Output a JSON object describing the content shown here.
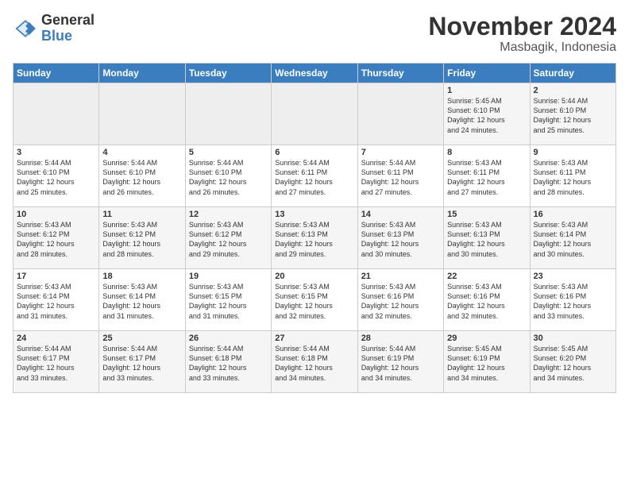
{
  "logo": {
    "general": "General",
    "blue": "Blue"
  },
  "title": "November 2024",
  "location": "Masbagik, Indonesia",
  "days_of_week": [
    "Sunday",
    "Monday",
    "Tuesday",
    "Wednesday",
    "Thursday",
    "Friday",
    "Saturday"
  ],
  "weeks": [
    [
      {
        "day": "",
        "info": ""
      },
      {
        "day": "",
        "info": ""
      },
      {
        "day": "",
        "info": ""
      },
      {
        "day": "",
        "info": ""
      },
      {
        "day": "",
        "info": ""
      },
      {
        "day": "1",
        "info": "Sunrise: 5:45 AM\nSunset: 6:10 PM\nDaylight: 12 hours\nand 24 minutes."
      },
      {
        "day": "2",
        "info": "Sunrise: 5:44 AM\nSunset: 6:10 PM\nDaylight: 12 hours\nand 25 minutes."
      }
    ],
    [
      {
        "day": "3",
        "info": "Sunrise: 5:44 AM\nSunset: 6:10 PM\nDaylight: 12 hours\nand 25 minutes."
      },
      {
        "day": "4",
        "info": "Sunrise: 5:44 AM\nSunset: 6:10 PM\nDaylight: 12 hours\nand 26 minutes."
      },
      {
        "day": "5",
        "info": "Sunrise: 5:44 AM\nSunset: 6:10 PM\nDaylight: 12 hours\nand 26 minutes."
      },
      {
        "day": "6",
        "info": "Sunrise: 5:44 AM\nSunset: 6:11 PM\nDaylight: 12 hours\nand 27 minutes."
      },
      {
        "day": "7",
        "info": "Sunrise: 5:44 AM\nSunset: 6:11 PM\nDaylight: 12 hours\nand 27 minutes."
      },
      {
        "day": "8",
        "info": "Sunrise: 5:43 AM\nSunset: 6:11 PM\nDaylight: 12 hours\nand 27 minutes."
      },
      {
        "day": "9",
        "info": "Sunrise: 5:43 AM\nSunset: 6:11 PM\nDaylight: 12 hours\nand 28 minutes."
      }
    ],
    [
      {
        "day": "10",
        "info": "Sunrise: 5:43 AM\nSunset: 6:12 PM\nDaylight: 12 hours\nand 28 minutes."
      },
      {
        "day": "11",
        "info": "Sunrise: 5:43 AM\nSunset: 6:12 PM\nDaylight: 12 hours\nand 28 minutes."
      },
      {
        "day": "12",
        "info": "Sunrise: 5:43 AM\nSunset: 6:12 PM\nDaylight: 12 hours\nand 29 minutes."
      },
      {
        "day": "13",
        "info": "Sunrise: 5:43 AM\nSunset: 6:13 PM\nDaylight: 12 hours\nand 29 minutes."
      },
      {
        "day": "14",
        "info": "Sunrise: 5:43 AM\nSunset: 6:13 PM\nDaylight: 12 hours\nand 30 minutes."
      },
      {
        "day": "15",
        "info": "Sunrise: 5:43 AM\nSunset: 6:13 PM\nDaylight: 12 hours\nand 30 minutes."
      },
      {
        "day": "16",
        "info": "Sunrise: 5:43 AM\nSunset: 6:14 PM\nDaylight: 12 hours\nand 30 minutes."
      }
    ],
    [
      {
        "day": "17",
        "info": "Sunrise: 5:43 AM\nSunset: 6:14 PM\nDaylight: 12 hours\nand 31 minutes."
      },
      {
        "day": "18",
        "info": "Sunrise: 5:43 AM\nSunset: 6:14 PM\nDaylight: 12 hours\nand 31 minutes."
      },
      {
        "day": "19",
        "info": "Sunrise: 5:43 AM\nSunset: 6:15 PM\nDaylight: 12 hours\nand 31 minutes."
      },
      {
        "day": "20",
        "info": "Sunrise: 5:43 AM\nSunset: 6:15 PM\nDaylight: 12 hours\nand 32 minutes."
      },
      {
        "day": "21",
        "info": "Sunrise: 5:43 AM\nSunset: 6:16 PM\nDaylight: 12 hours\nand 32 minutes."
      },
      {
        "day": "22",
        "info": "Sunrise: 5:43 AM\nSunset: 6:16 PM\nDaylight: 12 hours\nand 32 minutes."
      },
      {
        "day": "23",
        "info": "Sunrise: 5:43 AM\nSunset: 6:16 PM\nDaylight: 12 hours\nand 33 minutes."
      }
    ],
    [
      {
        "day": "24",
        "info": "Sunrise: 5:44 AM\nSunset: 6:17 PM\nDaylight: 12 hours\nand 33 minutes."
      },
      {
        "day": "25",
        "info": "Sunrise: 5:44 AM\nSunset: 6:17 PM\nDaylight: 12 hours\nand 33 minutes."
      },
      {
        "day": "26",
        "info": "Sunrise: 5:44 AM\nSunset: 6:18 PM\nDaylight: 12 hours\nand 33 minutes."
      },
      {
        "day": "27",
        "info": "Sunrise: 5:44 AM\nSunset: 6:18 PM\nDaylight: 12 hours\nand 34 minutes."
      },
      {
        "day": "28",
        "info": "Sunrise: 5:44 AM\nSunset: 6:19 PM\nDaylight: 12 hours\nand 34 minutes."
      },
      {
        "day": "29",
        "info": "Sunrise: 5:45 AM\nSunset: 6:19 PM\nDaylight: 12 hours\nand 34 minutes."
      },
      {
        "day": "30",
        "info": "Sunrise: 5:45 AM\nSunset: 6:20 PM\nDaylight: 12 hours\nand 34 minutes."
      }
    ]
  ]
}
